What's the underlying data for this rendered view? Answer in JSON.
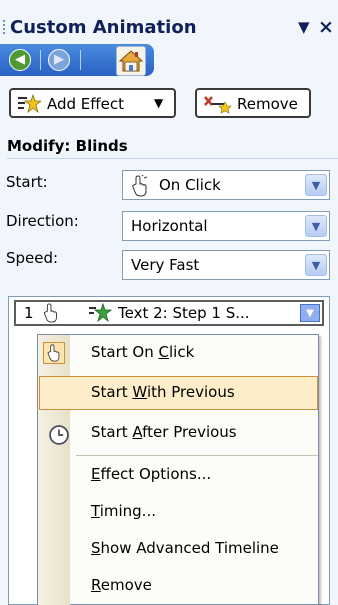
{
  "pane": {
    "title": "Custom Animation",
    "dropdown_glyph": "▼",
    "close_glyph": "×",
    "nav": {
      "back_icon": "back-arrow-icon",
      "forward_icon": "forward-arrow-icon",
      "home_icon": "home-icon"
    }
  },
  "toolbar": {
    "add_effect_label": "Add Effect",
    "add_effect_arrow": "▼",
    "remove_label": "Remove"
  },
  "modify": {
    "section_title": "Modify: Blinds",
    "fields": [
      {
        "label": "Start:",
        "value": "On Click",
        "icon": "mouse-click-icon"
      },
      {
        "label": "Direction:",
        "value": "Horizontal"
      },
      {
        "label": "Speed:",
        "value": "Very Fast"
      }
    ],
    "arrow_glyph": "▼"
  },
  "list": {
    "items": [
      {
        "number": "1",
        "text": "Text 2: Step 1 S...",
        "icon": "star-effect-icon"
      }
    ],
    "arrow_glyph": "▼"
  },
  "context_menu": {
    "items": [
      {
        "before": "Start On ",
        "key": "C",
        "after": "lick",
        "icon": "mouse-click-icon",
        "checked": true
      },
      {
        "before": "Start ",
        "key": "W",
        "after": "ith Previous",
        "highlighted": true
      },
      {
        "before": "Start ",
        "key": "A",
        "after": "fter Previous",
        "icon": "clock-icon"
      },
      {
        "before": "",
        "key": "E",
        "after": "ffect Options..."
      },
      {
        "before": "",
        "key": "T",
        "after": "iming..."
      },
      {
        "before": "",
        "key": "S",
        "after": "how Advanced Timeline"
      },
      {
        "before": "",
        "key": "R",
        "after": "emove"
      }
    ]
  },
  "colors": {
    "pane_bg": "#f1f6fd",
    "title_text": "#10215a",
    "nav_blue": "#2a62c4",
    "nav_green": "#4f9a33",
    "menu_highlight": "#fdeec9",
    "menu_highlight_border": "#d18f3a"
  }
}
